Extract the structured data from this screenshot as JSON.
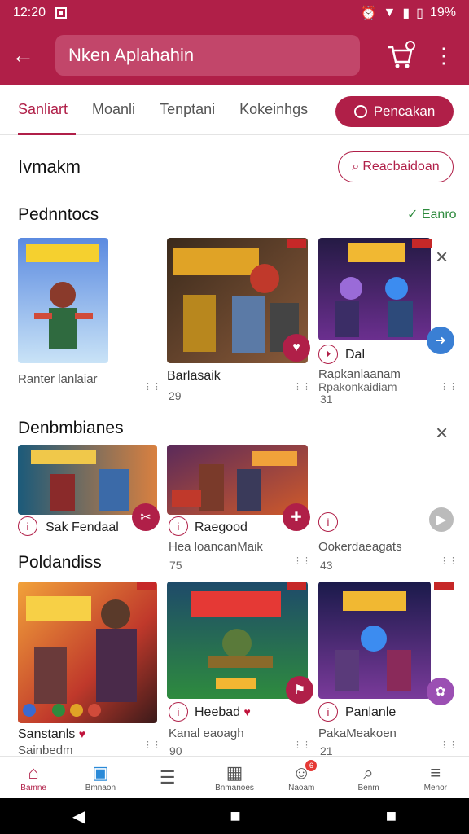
{
  "status": {
    "time": "12:20",
    "battery": "19%"
  },
  "appbar": {
    "search_text": "Nken Aplahahin"
  },
  "tabs": [
    "Sanliart",
    "Moanli",
    "Tenptani",
    "Kokeinhgs"
  ],
  "tab_pill": "Pencakan",
  "page": {
    "title": "Ivmakm",
    "action_button": "Reacbaidoan"
  },
  "sections": {
    "s1": {
      "title": "Pednntocs",
      "action": "Eanro"
    },
    "s2": {
      "title": "Denbmbianes"
    },
    "s3": {
      "title": "Poldandiss"
    }
  },
  "row1": [
    {
      "title": "Ranter lanlaiar"
    },
    {
      "title": "Barlasaik",
      "count": "29"
    },
    {
      "title": "Dal",
      "sub": "Rapkanlaanam",
      "sub2": "Rpakonkaidiam",
      "count": "31"
    }
  ],
  "row2": [
    {
      "title": "Sak Fendaal"
    },
    {
      "title": "Raegood",
      "sub": "Hea loancanMaik",
      "count": "75"
    },
    {
      "sub": "Ookerdaeagats",
      "count": "43"
    }
  ],
  "row3": [
    {
      "title": "Sanstanls",
      "sub": "Sainbedm"
    },
    {
      "title": "Heebad",
      "sub": "Kanal eaoagh",
      "count": "90"
    },
    {
      "title": "Panlanle",
      "sub": "PakaMeakoen",
      "count": "21"
    }
  ],
  "bottomnav": [
    {
      "label": "Bamne",
      "icon": "home-icon",
      "badge": ""
    },
    {
      "label": "Bmnaon",
      "icon": "store-icon",
      "badge": ""
    },
    {
      "label": "",
      "icon": "list-icon",
      "badge": ""
    },
    {
      "label": "Bnmanoes",
      "icon": "grid-icon",
      "badge": ""
    },
    {
      "label": "Naoam",
      "icon": "people-icon",
      "badge": "6"
    },
    {
      "label": "Benm",
      "icon": "search-icon",
      "badge": ""
    },
    {
      "label": "Menor",
      "icon": "menu-icon",
      "badge": ""
    }
  ],
  "colors": {
    "primary": "#b01f48",
    "accent_green": "#2e8b3e",
    "blue": "#3a7fd4"
  }
}
